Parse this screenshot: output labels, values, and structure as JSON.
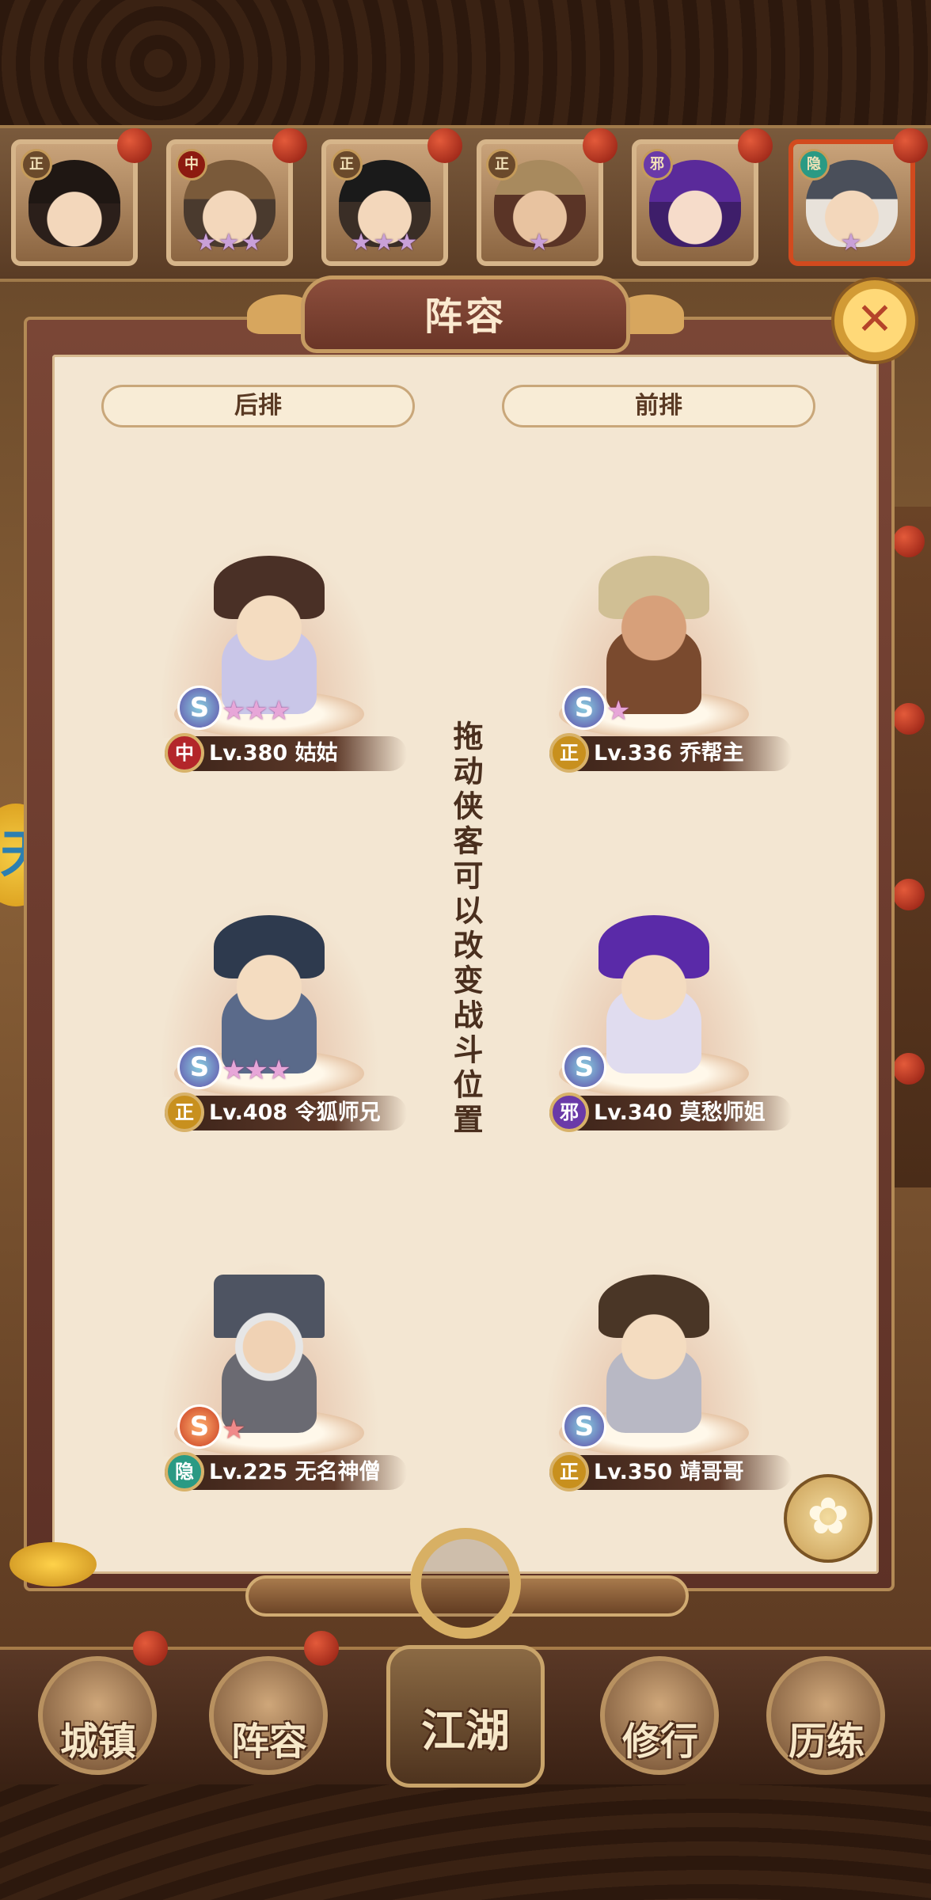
{
  "roster": [
    {
      "faction": "正",
      "stars": ""
    },
    {
      "faction": "中",
      "stars": "★★★"
    },
    {
      "faction": "正",
      "stars": "★★★"
    },
    {
      "faction": "正",
      "stars": "★"
    },
    {
      "faction": "邪",
      "stars": ""
    },
    {
      "faction": "隐",
      "stars": "★"
    }
  ],
  "side_badge": "天",
  "panel": {
    "title": "阵容",
    "close_symbol": "✕",
    "back_row_label": "后排",
    "front_row_label": "前排",
    "tip": "拖动侠客可以改变战斗位置"
  },
  "heroes": {
    "back": [
      {
        "faction": "中",
        "level_name": "Lv.380 姑姑",
        "stars": "★★★",
        "badge": "S"
      },
      {
        "faction": "正",
        "level_name": "Lv.408 令狐师兄",
        "stars": "★★★",
        "badge": "S"
      },
      {
        "faction": "隐",
        "level_name": "Lv.225 无名神僧",
        "stars": "★",
        "badge": "S"
      }
    ],
    "front": [
      {
        "faction": "正",
        "level_name": "Lv.336 乔帮主",
        "stars": "★",
        "badge": "S"
      },
      {
        "faction": "邪",
        "level_name": "Lv.340 莫愁师姐",
        "stars": "",
        "badge": "S"
      },
      {
        "faction": "正",
        "level_name": "Lv.350 靖哥哥",
        "stars": "",
        "badge": "S"
      }
    ]
  },
  "nav": {
    "town": "城镇",
    "lineup": "阵容",
    "jianghu": "江湖",
    "training": "修行",
    "trial": "历练"
  },
  "colors": {
    "panel_bg": "#f3e6d2",
    "frame": "#7a4636",
    "gold": "#d8b064",
    "faction_zheng": "#c8901e",
    "faction_zhong": "#b3262a",
    "faction_xie": "#6a3aa8",
    "faction_yin": "#2a9a84"
  }
}
